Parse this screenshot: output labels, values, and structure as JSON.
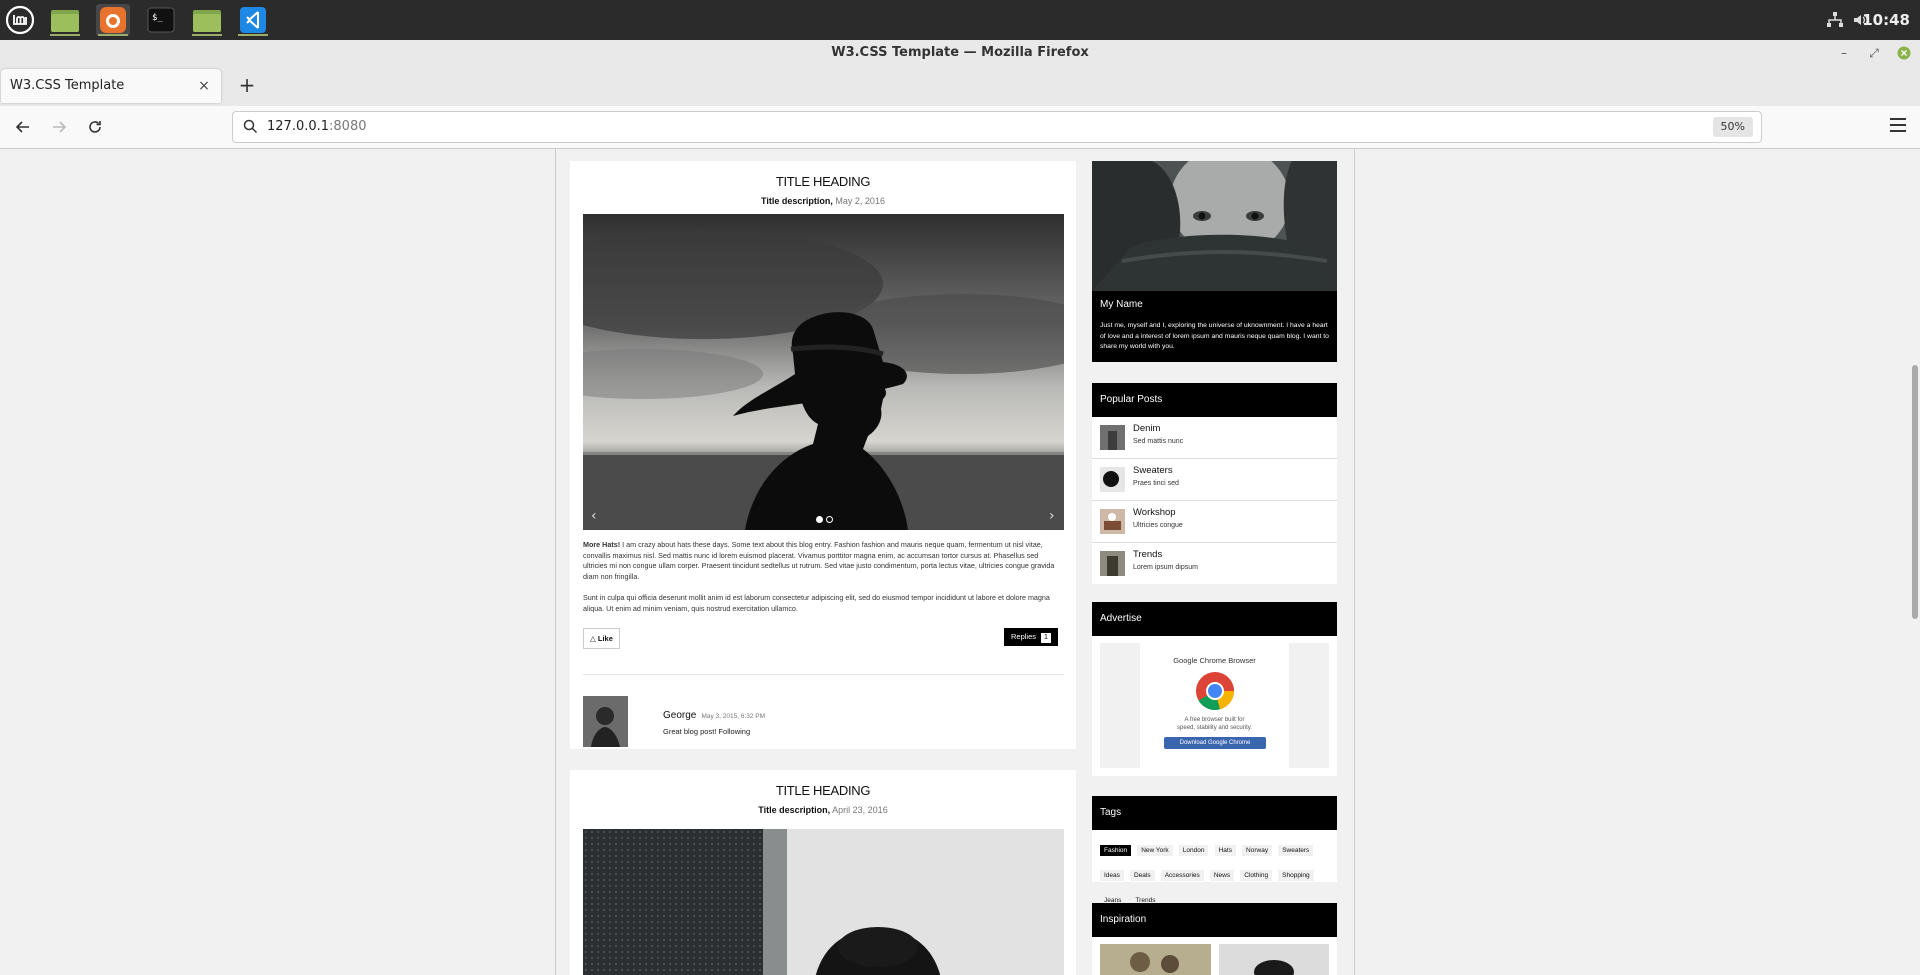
{
  "taskbar": {
    "apps": [
      "mint-menu",
      "files",
      "firefox",
      "terminal",
      "files",
      "vscode"
    ],
    "clock": "10:48"
  },
  "window": {
    "title": "W3.CSS Template — Mozilla Firefox"
  },
  "tabs": [
    {
      "label": "W3.CSS Template",
      "close": "×"
    }
  ],
  "newtab_label": "+",
  "urlbar": {
    "host": "127.0.0.1",
    "port": ":8080",
    "zoom": "50%"
  },
  "posts": [
    {
      "title": "TITLE HEADING",
      "desc_label": "Title description,",
      "date": "May 2, 2016",
      "prev": "‹",
      "next": "›",
      "lead": "More Hats!",
      "paragraph1": " I am crazy about hats these days. Some text about this blog entry. Fashion fashion and mauris neque quam, fermentum ut nisl vitae, convallis maximus nisl. Sed mattis nunc id lorem euismod placerat. Vivamus porttitor magna enim, ac accumsan tortor cursus at. Phasellus sed ultricies mi non congue ullam corper. Praesent tincidunt sedtellus ut rutrum. Sed vitae justo condimentum, porta lectus vitae, ultricies congue gravida diam non fringilla.",
      "paragraph2": "Sunt in culpa qui officia deserunt mollit anim id est laborum consectetur adipiscing elit, sed do eiusmod tempor incididunt ut labore et dolore magna aliqua. Ut enim ad minim veniam, quis nostrud exercitation ullamco.",
      "like_label": "Like",
      "like_icon": "thumbs-up-icon",
      "replies_label": "Replies",
      "replies_count": "1",
      "comment": {
        "author": "George",
        "date": "May 3, 2015, 6:32 PM",
        "text": "Great blog post! Following"
      }
    },
    {
      "title": "TITLE HEADING",
      "desc_label": "Title description,",
      "date": "April 23, 2016"
    }
  ],
  "about": {
    "name": "My Name",
    "text": "Just me, myself and I, exploring the universe of uknownment. I have a heart of love and a interest of lorem ipsum and mauris neque quam blog. I want to share my world with you."
  },
  "popular": {
    "heading": "Popular Posts",
    "items": [
      {
        "title": "Denim",
        "sub": "Sed mattis nunc"
      },
      {
        "title": "Sweaters",
        "sub": "Praes tinci sed"
      },
      {
        "title": "Workshop",
        "sub": "Ultricies congue"
      },
      {
        "title": "Trends",
        "sub": "Lorem ipsum dipsum"
      }
    ]
  },
  "advertise": {
    "heading": "Advertise",
    "ad_title": "Google Chrome Browser",
    "ad_line1": "A free browser built for",
    "ad_line2": "speed, stability and security.",
    "ad_button": "Download Google Chrome"
  },
  "tags": {
    "heading": "Tags",
    "items": [
      "Fashion",
      "New York",
      "London",
      "Hats",
      "Norway",
      "Sweaters",
      "Ideas",
      "Deals",
      "Accessories",
      "News",
      "Clothing",
      "Shopping",
      "Jeans",
      "Trends"
    ]
  },
  "inspiration": {
    "heading": "Inspiration"
  },
  "colors": {
    "taskbar": "#2b2b2b",
    "accent_black": "#000000",
    "page_bg": "#f1f1f1"
  }
}
